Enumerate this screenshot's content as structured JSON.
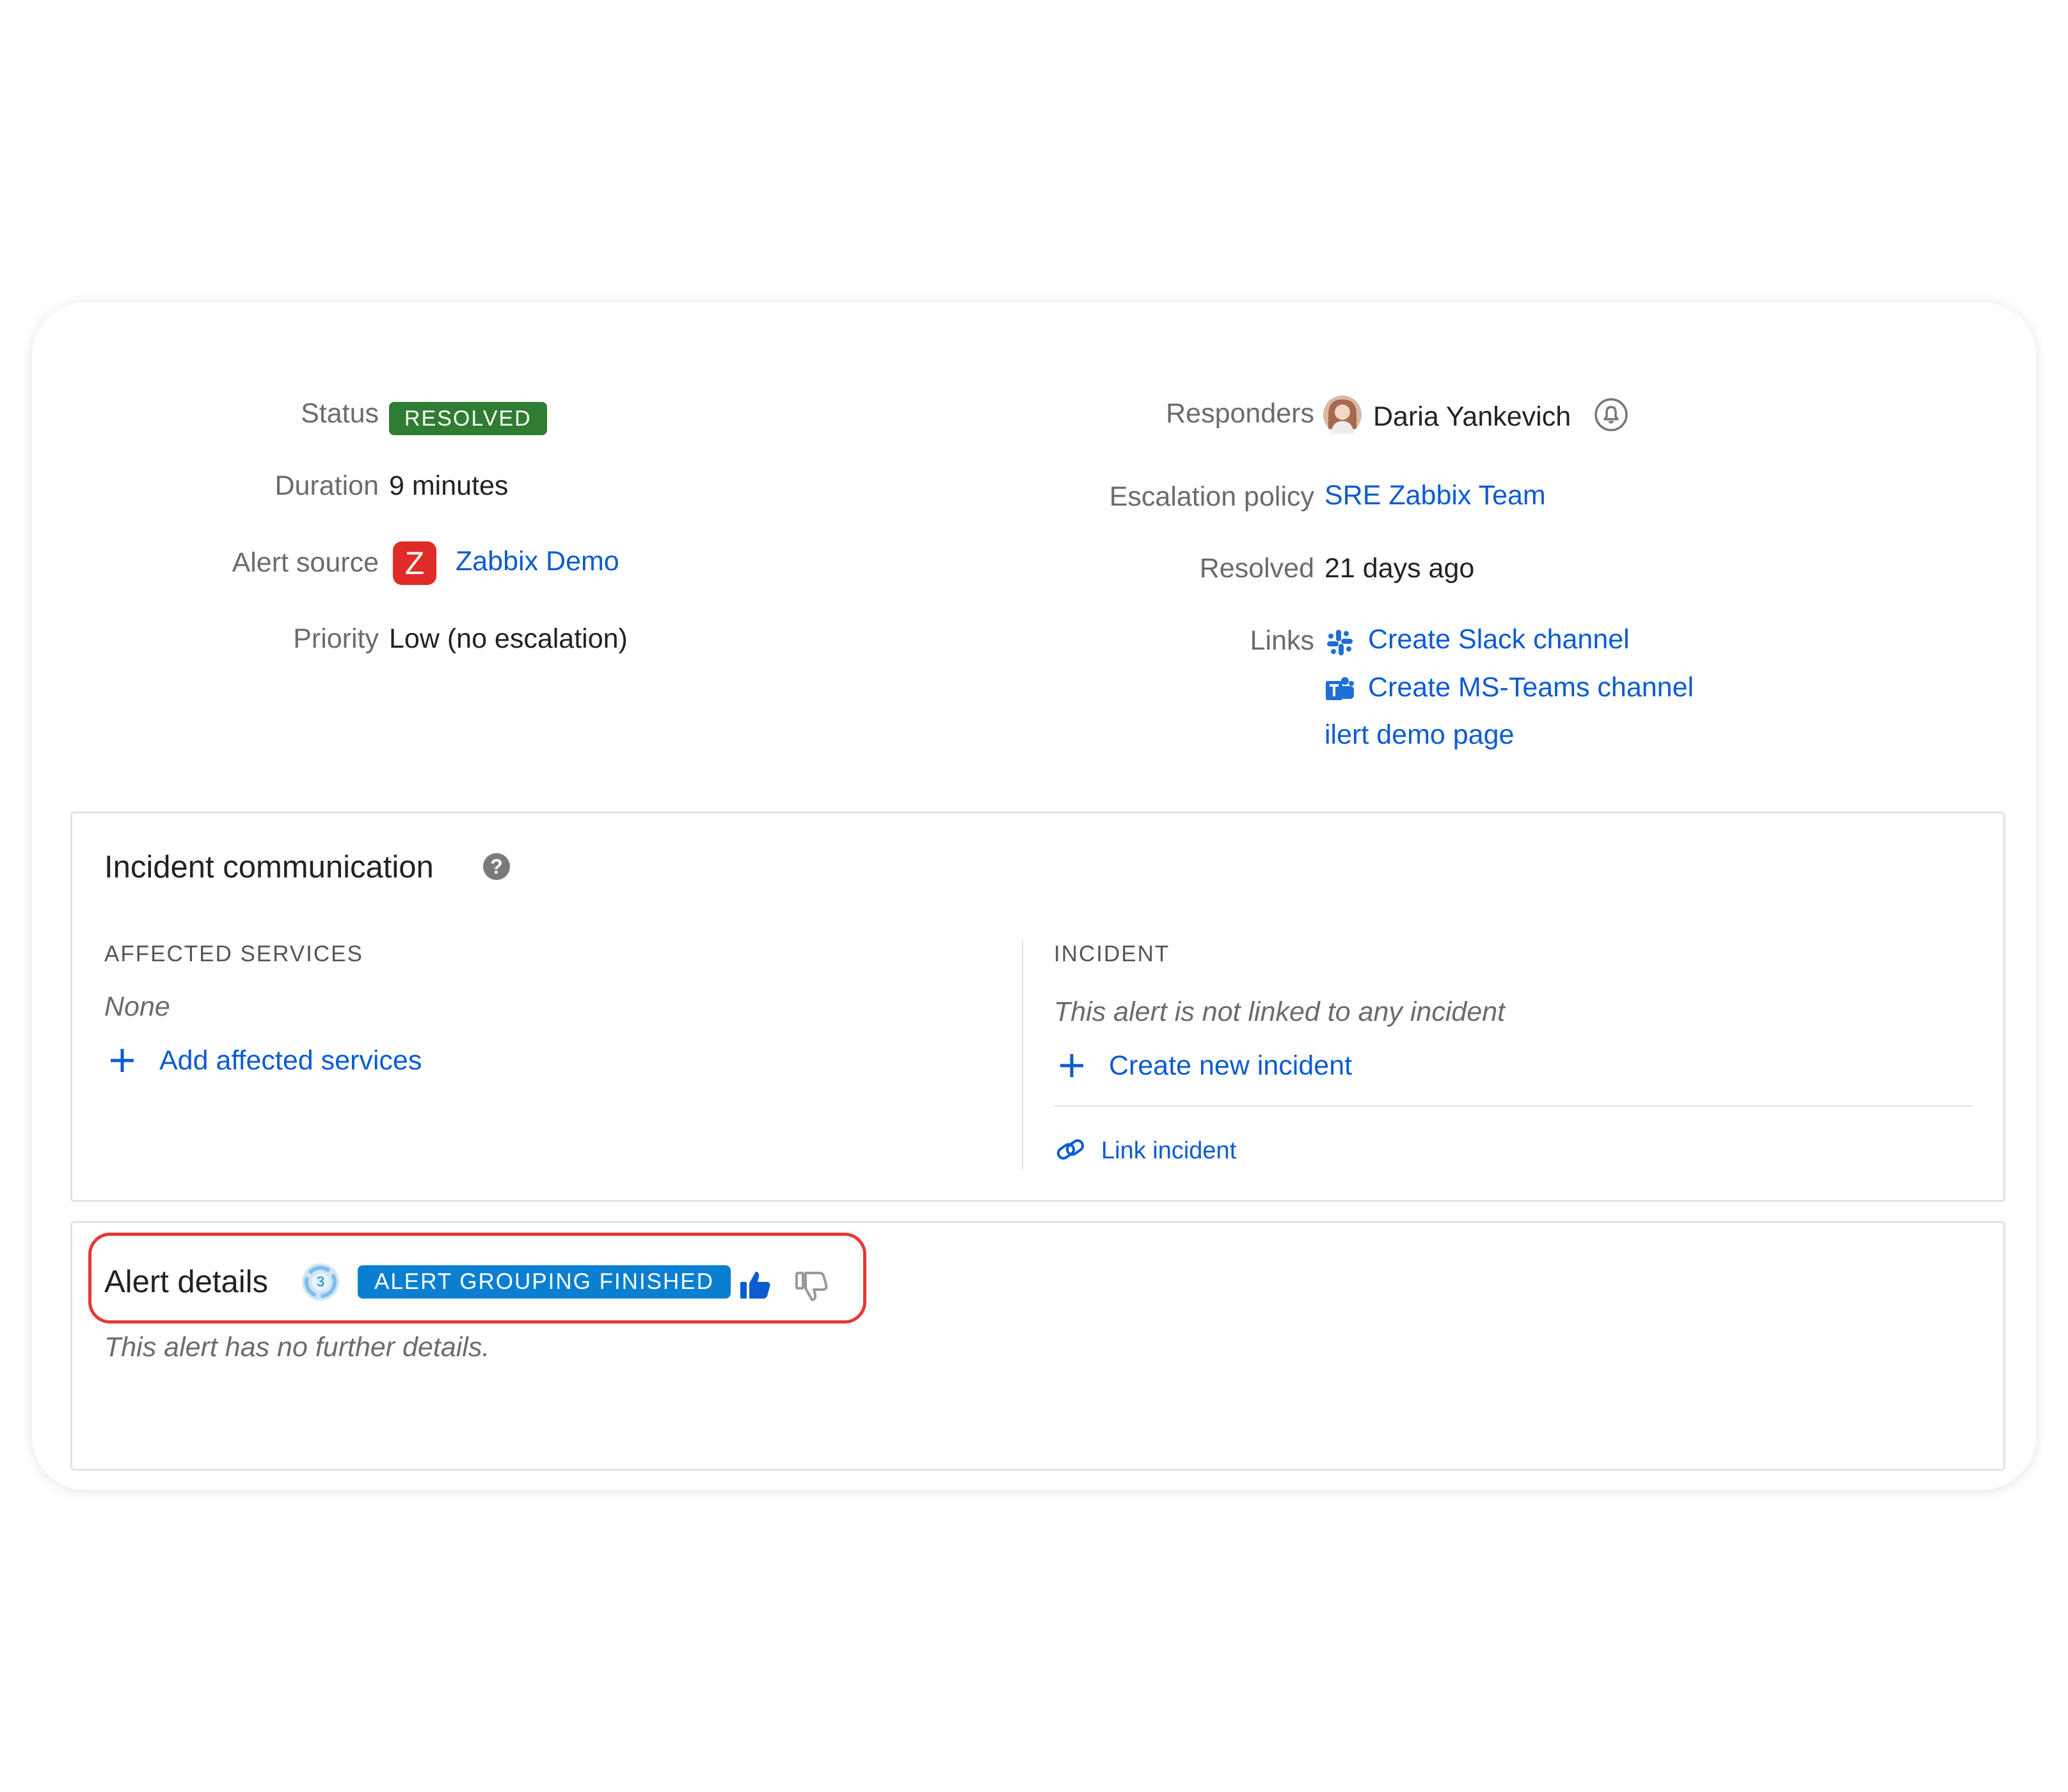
{
  "summary": {
    "status": {
      "label": "Status",
      "value": "RESOLVED",
      "color": "#2f7d32"
    },
    "duration": {
      "label": "Duration",
      "value": "9 minutes"
    },
    "alert_source": {
      "label": "Alert source",
      "value": "Zabbix Demo",
      "icon_letter": "Z",
      "icon_color": "#e02b27"
    },
    "priority": {
      "label": "Priority",
      "value": "Low (no escalation)"
    },
    "responders": {
      "label": "Responders",
      "value": "Daria Yankevich"
    },
    "escalation_policy": {
      "label": "Escalation policy",
      "value": "SRE Zabbix Team"
    },
    "resolved": {
      "label": "Resolved",
      "value": "21 days ago"
    },
    "links": {
      "label": "Links",
      "items": [
        {
          "label": "Create Slack channel",
          "icon": "slack-icon"
        },
        {
          "label": "Create MS-Teams channel",
          "icon": "teams-icon"
        },
        {
          "label": "ilert demo page",
          "icon": ""
        }
      ]
    }
  },
  "incident_communication": {
    "title": "Incident communication",
    "affected_services": {
      "heading": "AFFECTED SERVICES",
      "empty": "None",
      "add_label": "Add affected services"
    },
    "incident": {
      "heading": "INCIDENT",
      "empty": "This alert is not linked to any incident",
      "create_label": "Create new incident",
      "link_label": "Link incident"
    }
  },
  "alert_details": {
    "title": "Alert details",
    "group_count": "3",
    "grouping_badge": "ALERT GROUPING FINISHED",
    "empty": "This alert has no further details.",
    "accent_color": "#0a7fd1"
  },
  "colors": {
    "link": "#0b5bd1",
    "highlight": "#e53935"
  }
}
